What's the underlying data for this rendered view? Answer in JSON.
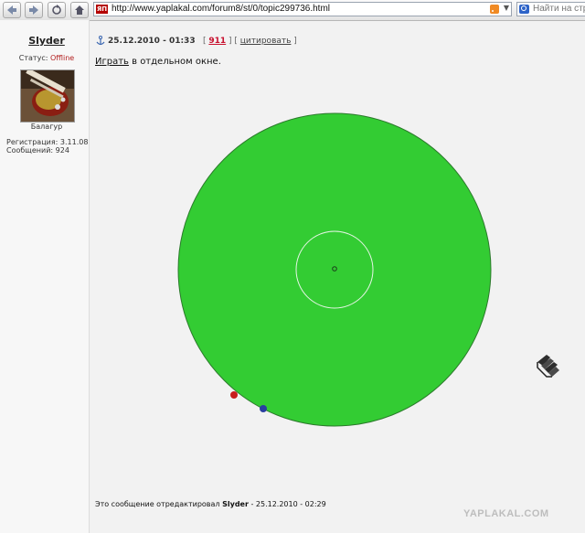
{
  "browser": {
    "url": "http://www.yaplakal.com/forum8/st/0/topic299736.html",
    "favicon_text": "ЯП",
    "search_placeholder": "Найти на стра"
  },
  "user": {
    "name": "Slyder",
    "status_label": "Статус:",
    "status_value": "Offline",
    "title": "Балагур",
    "registration": "Регистрация: 3.11.08",
    "messages": "Сообщений: 924"
  },
  "post": {
    "date": "25.12.2010 - 01:33",
    "number": "911",
    "cite_label": "цитировать",
    "play_link": "Играть",
    "play_rest": " в отдельном окне.",
    "edited_prefix": "Это сообщение отредактировал ",
    "edited_user": "Slyder",
    "edited_suffix": " - 25.12.2010 - 02:29"
  },
  "game": {
    "disc_color": "#33cc33",
    "player_colors": [
      "#c81e1e",
      "#2a3fa0"
    ]
  },
  "watermark": "YAPLAKAL.COM"
}
